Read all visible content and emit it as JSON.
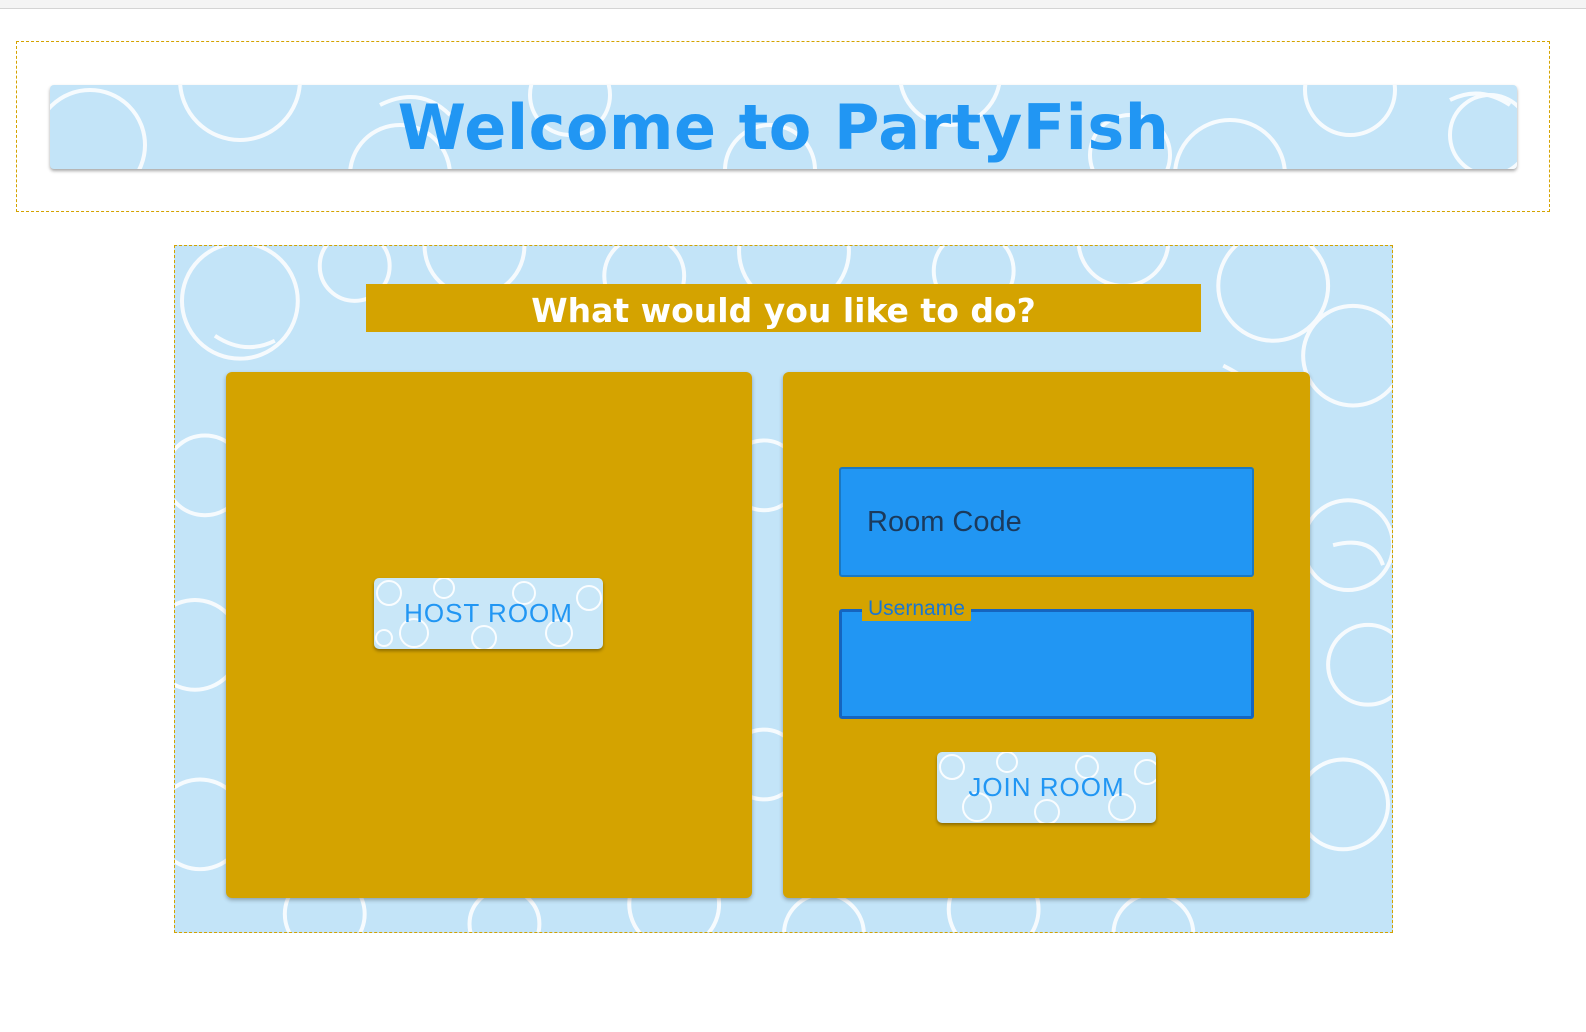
{
  "header": {
    "title": "Welcome to PartyFish"
  },
  "main": {
    "prompt": "What would you like to do?",
    "host_card": {
      "button_label": "HOST ROOM"
    },
    "join_card": {
      "room_code": {
        "placeholder": "Room Code",
        "value": ""
      },
      "username": {
        "label": "Username",
        "value": ""
      },
      "button_label": "JOIN ROOM"
    }
  },
  "colors": {
    "accent_gold": "#d4a300",
    "brand_blue": "#2196f3",
    "bubble_background": "#c3e4f8"
  }
}
